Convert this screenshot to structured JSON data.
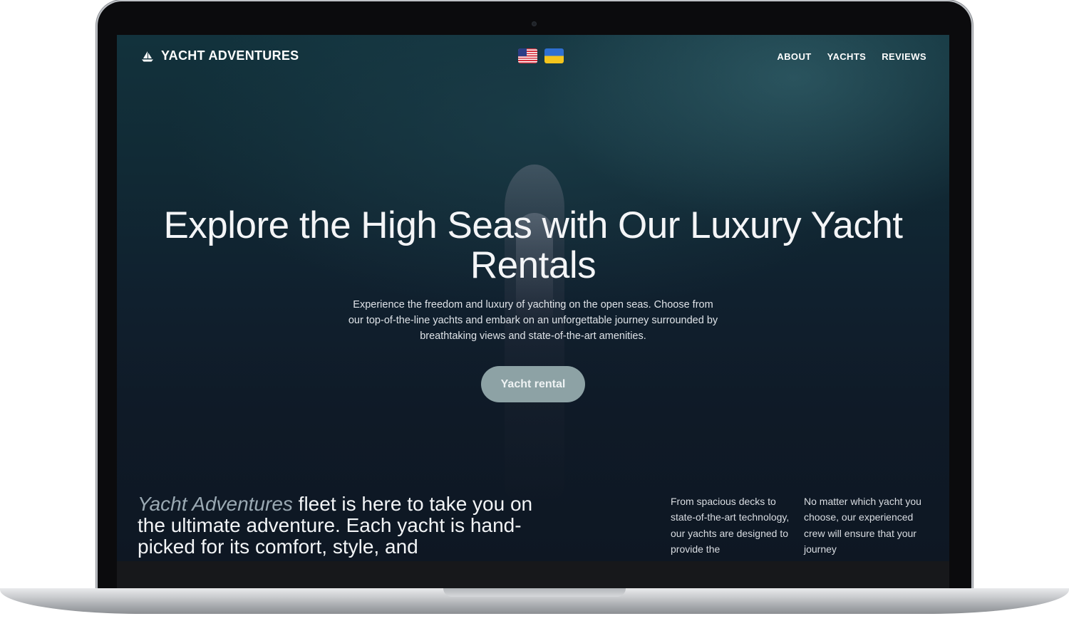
{
  "nav": {
    "brand": "YACHT ADVENTURES",
    "brand_icon": "sailboat-icon",
    "languages": [
      {
        "code": "en",
        "icon": "us-flag-icon"
      },
      {
        "code": "uk",
        "icon": "ukraine-flag-icon"
      }
    ],
    "links": [
      "ABOUT",
      "YACHTS",
      "REVIEWS"
    ]
  },
  "hero": {
    "title": "Explore the High Seas with Our Luxury Yacht Rentals",
    "subtitle": "Experience the freedom and luxury of yachting on the open seas. Choose from our top-of-the-line yachts and embark on an unforgettable journey surrounded by breathtaking views and state-of-the-art amenities.",
    "cta_label": "Yacht rental"
  },
  "fleet": {
    "brand": "Yacht Adventures",
    "text": " fleet is here to take you on the ultimate adventure. Each yacht is hand-picked for its comfort, style, and",
    "col1": "From spacious decks to state-of-the-art technology, our yachts are designed to provide the",
    "col2": "No matter which yacht you choose, our experienced crew will ensure that your journey"
  },
  "colors": {
    "cta_bg": "#8da2a5",
    "brand_italic": "#9aa9b3",
    "background": "#0f1a27"
  }
}
